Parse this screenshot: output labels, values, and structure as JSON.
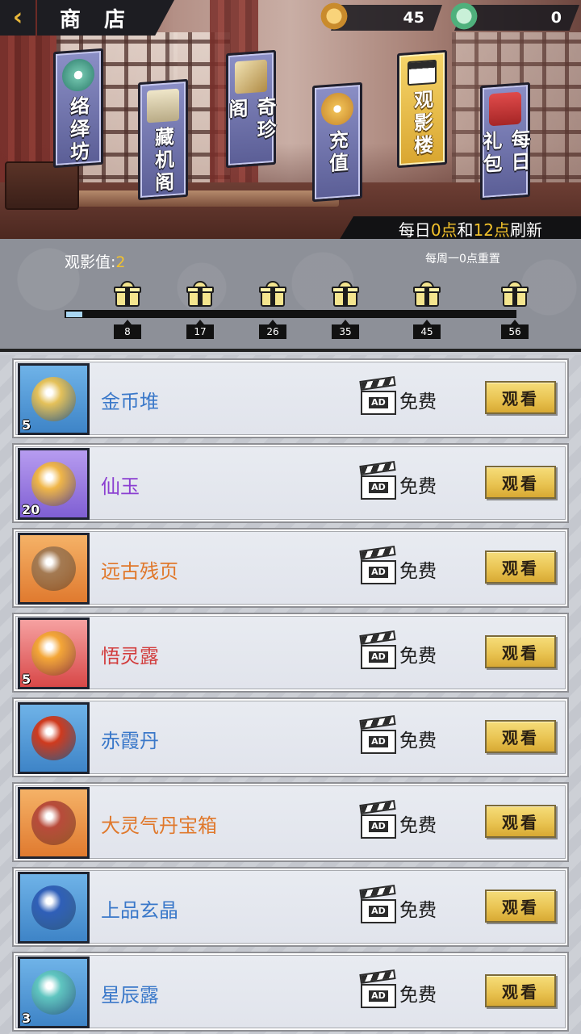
{
  "header": {
    "back_icon": "chevron-left-icon",
    "title": "商 店",
    "currencies": [
      {
        "icon": "gold-jade-icon",
        "amount": "45"
      },
      {
        "icon": "green-jade-icon",
        "amount": "0"
      }
    ]
  },
  "tabs": [
    {
      "label": "络绎坊",
      "icon": "dragon-statue-icon",
      "active": false
    },
    {
      "label": "藏机阁",
      "icon": "scroll-icon",
      "active": false
    },
    {
      "label": "奇珍阁",
      "icon": "scroll-roll-icon",
      "active": false
    },
    {
      "label": "充值",
      "icon": "jade-coin-icon",
      "active": false
    },
    {
      "label": "观影楼",
      "icon": "ad-clapper-icon",
      "active": true
    },
    {
      "label": "每日礼包",
      "icon": "gift-box-icon",
      "active": false
    }
  ],
  "refresh_note": {
    "prefix": "每日",
    "h1": "0点",
    "mid": "和",
    "h2": "12点",
    "suffix": "刷新"
  },
  "progress": {
    "label": "观影值:",
    "value": "2",
    "weekly_reset": "每周一0点重置",
    "max": 56,
    "milestones": [
      "8",
      "17",
      "26",
      "35",
      "45",
      "56"
    ]
  },
  "items": [
    {
      "name": "金币堆",
      "qty": "5",
      "color": "#3a78c9",
      "frame": "blue",
      "icon": "gold-coins-icon",
      "art": "#e4c15a",
      "price": "免费",
      "button": "观看"
    },
    {
      "name": "仙玉",
      "qty": "20",
      "color": "#8b3fd1",
      "frame": "purple",
      "icon": "jade-coin-icon",
      "art": "#f0b648",
      "price": "免费",
      "button": "观看"
    },
    {
      "name": "远古残页",
      "qty": "",
      "color": "#e0782b",
      "frame": "orange",
      "icon": "ancient-page-icon",
      "art": "#a47a52",
      "price": "免费",
      "button": "观看"
    },
    {
      "name": "悟灵露",
      "qty": "5",
      "color": "#d23c3c",
      "frame": "red",
      "icon": "dew-drop-icon",
      "art": "#f4a637",
      "price": "免费",
      "button": "观看"
    },
    {
      "name": "赤霞丹",
      "qty": "",
      "color": "#3a78c9",
      "frame": "blue",
      "icon": "red-pill-icon",
      "art": "#cf3a1e",
      "price": "免费",
      "button": "观看"
    },
    {
      "name": "大灵气丹宝箱",
      "qty": "",
      "color": "#e0782b",
      "frame": "orange",
      "icon": "treasure-chest-icon",
      "art": "#b84b3a",
      "price": "免费",
      "button": "观看"
    },
    {
      "name": "上品玄晶",
      "qty": "",
      "color": "#3a78c9",
      "frame": "blue",
      "icon": "crystal-icon",
      "art": "#2f5fb8",
      "price": "免费",
      "button": "观看"
    },
    {
      "name": "星辰露",
      "qty": "3",
      "color": "#3a78c9",
      "frame": "blue",
      "icon": "star-dew-vessel-icon",
      "art": "#5fc5c0",
      "price": "免费",
      "button": "观看"
    }
  ]
}
